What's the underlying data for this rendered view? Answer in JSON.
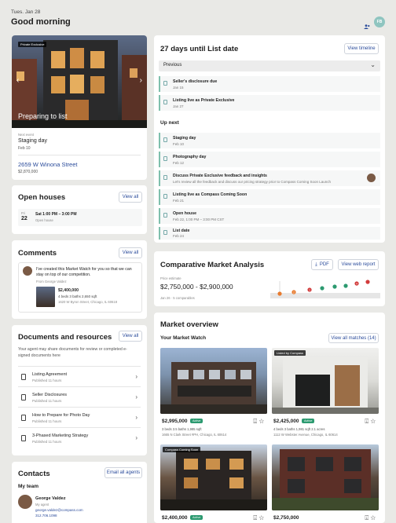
{
  "header": {
    "date": "Tues. Jan 28",
    "greeting": "Good morning",
    "avatar_initials": "FB"
  },
  "property": {
    "image_tag": "Private Exclusive",
    "overlay_title": "Preparing to list",
    "next_event_label": "Next event",
    "next_event": "Staging day",
    "next_event_date": "Feb 10",
    "address": "2659 W Winona Street",
    "price": "$2,870,000"
  },
  "open_houses": {
    "title": "Open houses",
    "view_all": "View all",
    "day_abbr": "Fri",
    "day_num": "22",
    "time": "Sat 1:00 PM – 3:00 PM",
    "type": "Open house"
  },
  "comments": {
    "title": "Comments",
    "view_all": "View all",
    "message": "I've created this Market Watch for you so that we can stay on top of our competition.",
    "author": "From George Valdez",
    "listing_price": "$2,400,000",
    "listing_meta": "4 beds   3 baths   2,650 sqft",
    "listing_addr": "1620 W Byron Street, Chicago, IL 60618"
  },
  "documents": {
    "title": "Documents and resources",
    "view_all": "View all",
    "desc": "Your agent may share documents for review or completed e-signed documents here",
    "items": [
      {
        "title": "Listing Agreement",
        "sub": "Published 11 hours"
      },
      {
        "title": "Seller Disclosures",
        "sub": "Published 11 hours"
      },
      {
        "title": "How to Prepare for Photo Day",
        "sub": "Published 11 hours"
      },
      {
        "title": "3-Phased Marketing Strategy",
        "sub": "Published 11 hours"
      }
    ]
  },
  "contacts": {
    "title": "Contacts",
    "email_all": "Email all agents",
    "my_team": "My team",
    "name": "George Valdez",
    "role": "My agent",
    "email": "george.valdez@compass.com",
    "phone": "312.706.1098"
  },
  "timeline": {
    "title": "27 days until List date",
    "view_timeline": "View timeline",
    "previous_label": "Previous",
    "previous": [
      {
        "title": "Seller's disclosure due",
        "date": "Jan 15"
      },
      {
        "title": "Listing live as Private Exclusive",
        "date": "Jan 27"
      }
    ],
    "up_next_label": "Up next",
    "up_next": [
      {
        "title": "Staging day",
        "date": "Feb 10"
      },
      {
        "title": "Photography day",
        "date": "Feb 12"
      },
      {
        "title": "Discuss Private Exclusive feedback and insights",
        "date": "Let's review all the feedback and discuss our pricing strategy prior to Compass Coming Soon Launch"
      },
      {
        "title": "Listing live as Compass Coming Soon",
        "date": "Feb 21"
      },
      {
        "title": "Open house",
        "date": "Feb 22, 1:00 PM – 3:00 PM CST"
      },
      {
        "title": "List date",
        "date": "Feb 24"
      }
    ]
  },
  "cma": {
    "title": "Comparative Market Analysis",
    "pdf": "PDF",
    "view_web": "View web report",
    "estimate_label": "Price estimate",
    "estimate": "$2,750,000 - $2,900,000",
    "footnote": "Jan 26 · 5 comparables",
    "points": [
      {
        "label": "",
        "color": "#e87a2e"
      },
      {
        "label": "2",
        "color": "#e87a2e"
      },
      {
        "label": "1",
        "color": "#d23b3b"
      },
      {
        "label": "",
        "color": "#2c9a70"
      },
      {
        "label": "",
        "color": "#2c9a70"
      },
      {
        "label": "",
        "color": "#2c9a70"
      },
      {
        "label": "4",
        "color": "#d23b3b"
      },
      {
        "label": "",
        "color": "#d23b3b"
      }
    ]
  },
  "market": {
    "title": "Market overview",
    "subtitle": "Your Market Watch",
    "view_all": "View all matches (14)",
    "listings": [
      {
        "tag": "",
        "price": "$2,995,000",
        "badge": "Active",
        "meta": "3 beds   3.5 baths   1,985 sqft",
        "addr": "1665 N Clark Street #PH, Chicago, IL 60614"
      },
      {
        "tag": "Listed by Compass",
        "price": "$2,425,000",
        "badge": "Active",
        "meta": "4 beds   3 baths   1,981 sqft   2.1 acres",
        "addr": "1112 W Webster Avenue, Chicago, IL 60614"
      },
      {
        "tag": "Compass Coming Soon",
        "price": "$2,400,000",
        "badge": "Active",
        "meta": "",
        "addr": ""
      },
      {
        "tag": "",
        "price": "$2,750,000",
        "badge": "",
        "meta": "",
        "addr": ""
      }
    ]
  },
  "colors": {
    "accent": "#2b4c9b",
    "green": "#2c9a70",
    "bg": "#e9e9e6"
  }
}
